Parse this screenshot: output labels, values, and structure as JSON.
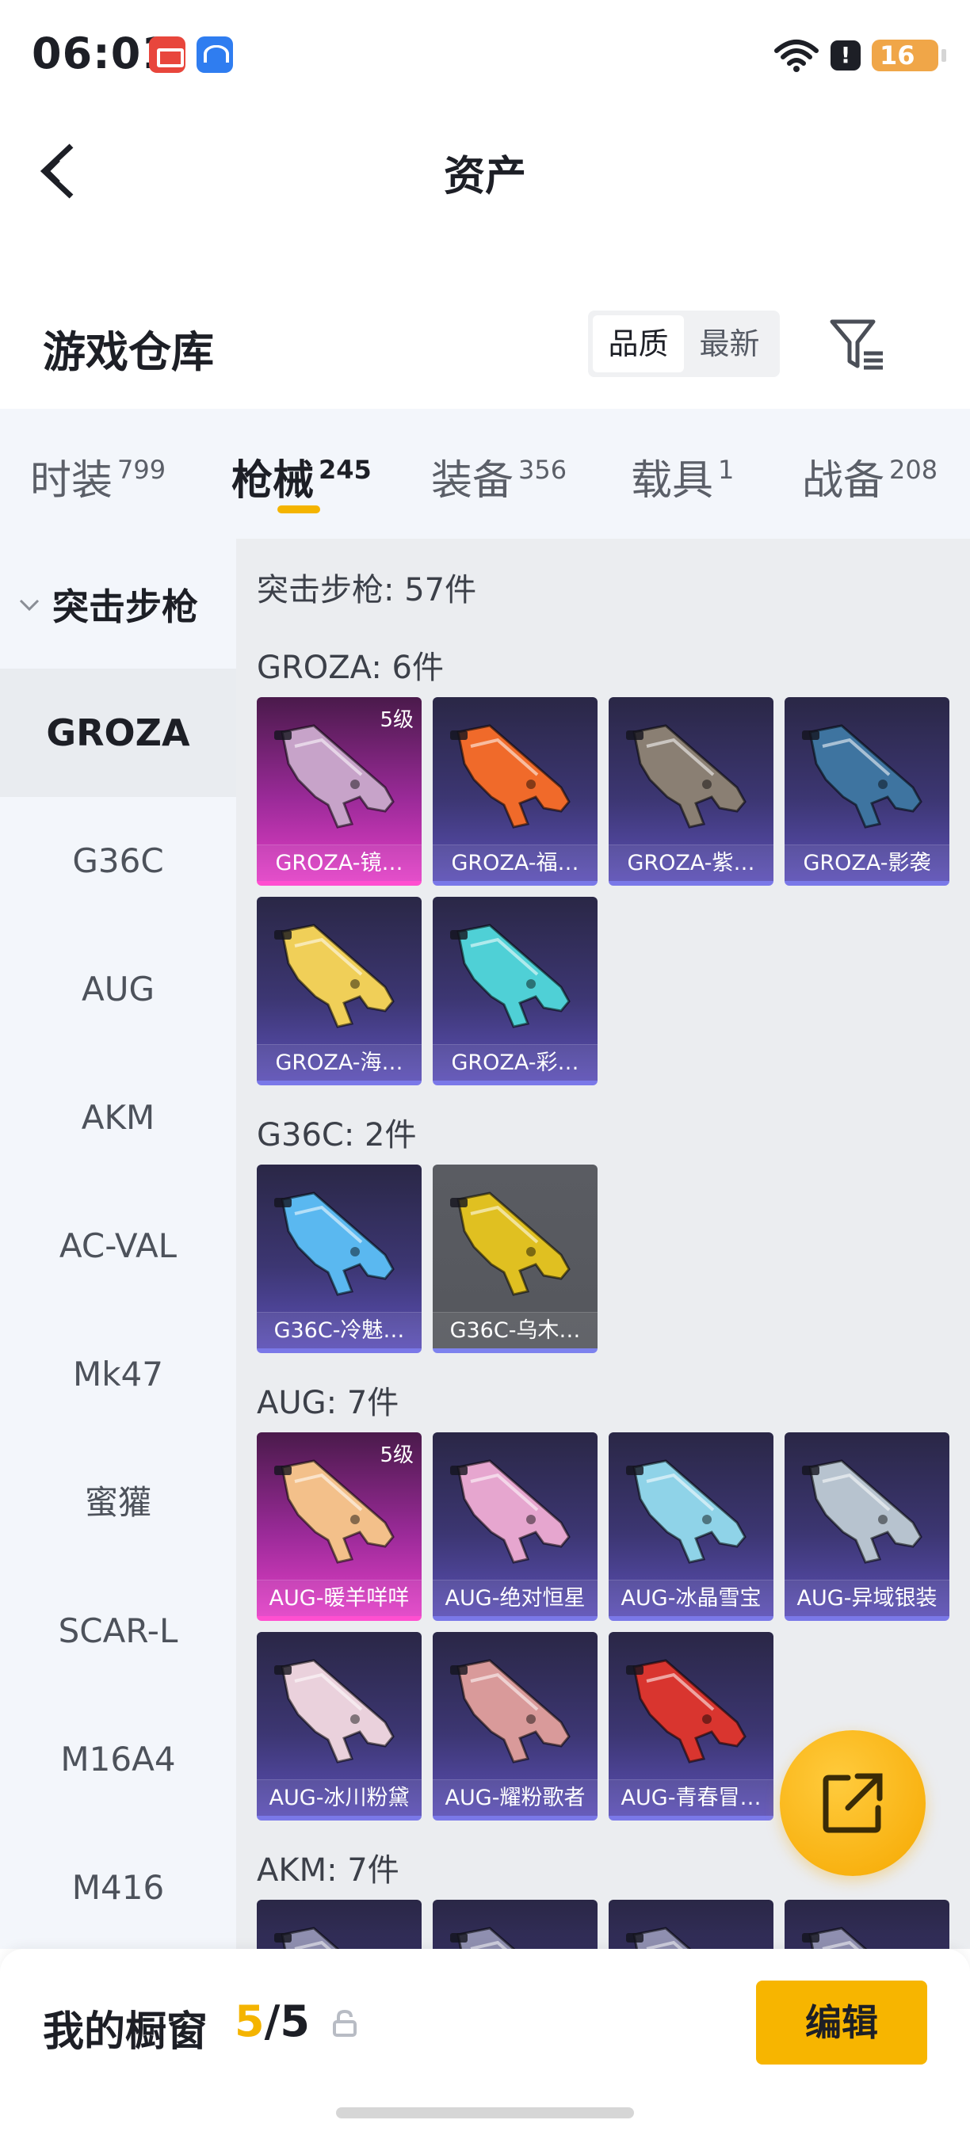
{
  "status": {
    "time": "06:01",
    "battery": "16",
    "alert": "!"
  },
  "header": {
    "title": "资产"
  },
  "warehouse": {
    "title": "游戏仓库",
    "sort_options": [
      "品质",
      "最新"
    ]
  },
  "tabs": [
    {
      "label": "时装",
      "count": "799"
    },
    {
      "label": "枪械",
      "count": "245"
    },
    {
      "label": "装备",
      "count": "356"
    },
    {
      "label": "载具",
      "count": "1"
    },
    {
      "label": "战备",
      "count": "208"
    }
  ],
  "sidebar": {
    "group": "突击步枪",
    "items": [
      "GROZA",
      "G36C",
      "AUG",
      "AKM",
      "AC-VAL",
      "Mk47",
      "蜜獾",
      "SCAR-L",
      "M16A4",
      "M416"
    ]
  },
  "main": {
    "summary": "突击步枪: 57件",
    "sections": [
      {
        "title": "GROZA: 6件",
        "items": [
          {
            "name": "GROZA-镜…",
            "level": "5级",
            "rarity": "pink",
            "accent": "#c7a3c9"
          },
          {
            "name": "GROZA-福…",
            "level": "",
            "rarity": "blue",
            "accent": "#f06a2a"
          },
          {
            "name": "GROZA-紫…",
            "level": "",
            "rarity": "blue",
            "accent": "#8a7f73"
          },
          {
            "name": "GROZA-影袭",
            "level": "",
            "rarity": "blue",
            "accent": "#3e74a0"
          },
          {
            "name": "GROZA-海…",
            "level": "",
            "rarity": "blue",
            "accent": "#f0cf58"
          },
          {
            "name": "GROZA-彩…",
            "level": "",
            "rarity": "blue",
            "accent": "#4fd0d6"
          }
        ]
      },
      {
        "title": "G36C: 2件",
        "items": [
          {
            "name": "G36C-冷魅…",
            "level": "",
            "rarity": "blue",
            "accent": "#5ab8f0"
          },
          {
            "name": "G36C-乌木…",
            "level": "",
            "rarity": "gray",
            "accent": "#e0c021"
          }
        ]
      },
      {
        "title": "AUG: 7件",
        "items": [
          {
            "name": "AUG-暖羊咩咩",
            "level": "5级",
            "rarity": "pink",
            "accent": "#f3c08a"
          },
          {
            "name": "AUG-绝对恒星",
            "level": "",
            "rarity": "blue",
            "accent": "#e6a6cf"
          },
          {
            "name": "AUG-冰晶雪宝",
            "level": "",
            "rarity": "blue",
            "accent": "#8fd3e8"
          },
          {
            "name": "AUG-异域银装",
            "level": "",
            "rarity": "blue",
            "accent": "#b7c3cf"
          },
          {
            "name": "AUG-冰川粉黛",
            "level": "",
            "rarity": "blue",
            "accent": "#ead1dc"
          },
          {
            "name": "AUG-耀粉歌者",
            "level": "",
            "rarity": "blue",
            "accent": "#d99a9a"
          },
          {
            "name": "AUG-青春冒…",
            "level": "",
            "rarity": "blue",
            "accent": "#d9352f"
          }
        ]
      },
      {
        "title": "AKM: 7件",
        "items": [
          {
            "name": "",
            "level": "",
            "rarity": "blue",
            "accent": "#8f8fb0"
          },
          {
            "name": "",
            "level": "",
            "rarity": "blue",
            "accent": "#8f8fb0"
          },
          {
            "name": "",
            "level": "",
            "rarity": "blue",
            "accent": "#8f8fb0"
          },
          {
            "name": "",
            "level": "",
            "rarity": "blue",
            "accent": "#8f8fb0"
          }
        ]
      }
    ]
  },
  "bottom": {
    "label": "我的橱窗",
    "current": "5",
    "separator": "/",
    "total": "5",
    "edit": "编辑"
  },
  "colors": {
    "accent": "#f4b400",
    "rarity_blue": "#7a78e8",
    "rarity_pink": "#ff4fd0"
  }
}
